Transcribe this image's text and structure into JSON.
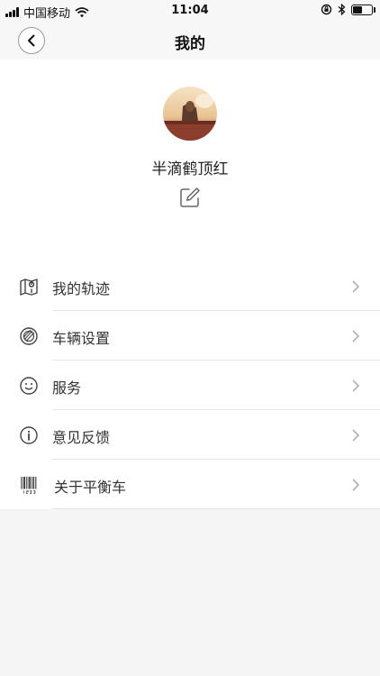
{
  "status_bar": {
    "carrier": "中国移动",
    "time": "11:04",
    "battery_level": 0.45
  },
  "nav": {
    "title": "我的",
    "back_icon": "chevron-left-icon"
  },
  "profile": {
    "username": "半滴鹤顶红",
    "edit_icon": "edit-icon"
  },
  "menu": {
    "items": [
      {
        "label": "我的轨迹",
        "icon": "map-icon"
      },
      {
        "label": "车辆设置",
        "icon": "wheel-icon"
      },
      {
        "label": "服务",
        "icon": "smiley-icon"
      },
      {
        "label": "意见反馈",
        "icon": "info-icon"
      },
      {
        "label": "关于平衡车",
        "icon": "barcode-icon"
      }
    ]
  },
  "colors": {
    "background": "#f5f5f5",
    "card": "#ffffff",
    "divider": "#e5e5e5",
    "chevron": "#b0b0b0"
  }
}
